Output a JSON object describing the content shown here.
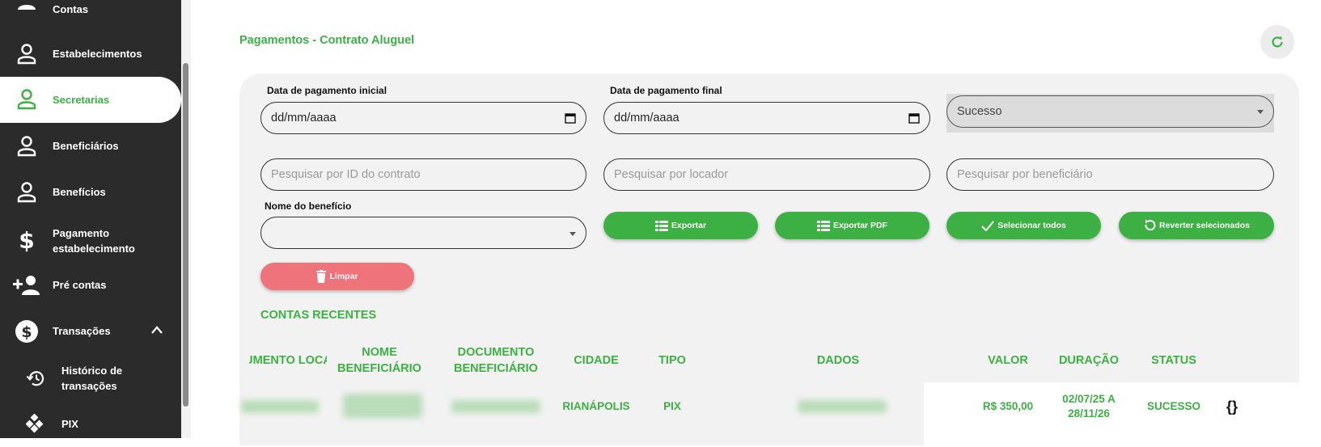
{
  "sidebar": {
    "items": [
      {
        "label": "Contas",
        "icon": "person-icon"
      },
      {
        "label": "Estabelecimentos",
        "icon": "person-outline-icon"
      },
      {
        "label": "Secretarias",
        "icon": "person-outline-icon",
        "active": true
      },
      {
        "label": "Beneficiários",
        "icon": "person-outline-icon"
      },
      {
        "label": "Benefícios",
        "icon": "person-outline-icon"
      },
      {
        "label": "Pagamento estabelecimento",
        "icon": "dollar-icon"
      },
      {
        "label": "Pré contas",
        "icon": "person-add-icon"
      },
      {
        "label": "Transações",
        "icon": "dollar-circle-icon",
        "expanded": true
      },
      {
        "label": "Histórico de transações",
        "icon": "history-icon"
      },
      {
        "label": "PIX",
        "icon": "pix-icon"
      }
    ]
  },
  "header": {
    "title": "Pagamentos - Contrato Aluguel"
  },
  "filters": {
    "start_date_label": "Data de pagamento inicial",
    "start_date_value": "dd/mm/aaaa",
    "end_date_label": "Data de pagamento final",
    "end_date_value": "dd/mm/aaaa",
    "status_value": "Sucesso",
    "contract_placeholder": "Pesquisar por ID do contrato",
    "landlord_placeholder": "Pesquisar por locador",
    "beneficiary_placeholder": "Pesquisar por beneficiário",
    "benefit_name_label": "Nome do benefício",
    "benefit_name_value": ""
  },
  "actions": {
    "export": "Exportar",
    "export_pdf": "Exportar PDF",
    "select_all": "Selecionar todos",
    "revert_selected": "Reverter selecionados",
    "clear": "Limpar"
  },
  "table": {
    "section_title": "CONTAS RECENTES",
    "columns": [
      "DOCUMENTO LOCADOR",
      "NOME BENEFICIÁRIO",
      "DOCUMENTO BENEFICIÁRIO",
      "CIDADE",
      "TIPO",
      "DADOS",
      "VALOR",
      "DURAÇÃO",
      "STATUS"
    ],
    "rows": [
      {
        "cidade": "RIANÁPOLIS",
        "tipo": "PIX",
        "valor": "R$ 350,00",
        "duracao": "02/07/25 A 28/11/26",
        "status": "SUCESSO",
        "action": "{}"
      }
    ]
  },
  "colors": {
    "accent": "#3db043",
    "danger": "#ee737b",
    "sidebar": "#2b2b2b"
  }
}
